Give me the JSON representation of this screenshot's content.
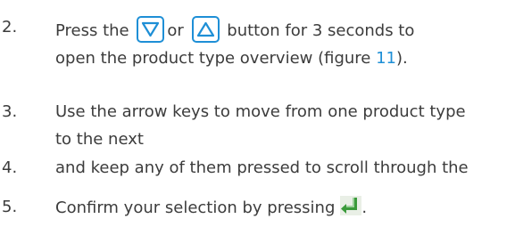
{
  "steps": [
    {
      "number": "2.",
      "line1_before": "Press the",
      "line1_middle": "or",
      "line1_after": "button for 3 seconds to",
      "line2_before": "open the product type overview (figure ",
      "figure_ref": "11",
      "line2_after": ")."
    },
    {
      "number": "3.",
      "line1": "Use the arrow keys to move from one product type",
      "line2": "to the next"
    },
    {
      "number": "4.",
      "line1": "and keep any of them pressed to scroll through the"
    },
    {
      "number": "5.",
      "line1": "Confirm your selection by pressing",
      "line1_after": "."
    }
  ],
  "icons": {
    "down_button": "down-triangle-button-icon",
    "up_button": "up-triangle-button-icon",
    "enter_key": "enter-key-icon"
  },
  "colors": {
    "text": "#3c3c3c",
    "accent": "#1e8fd6",
    "enter_icon": "#3a9a3a"
  }
}
